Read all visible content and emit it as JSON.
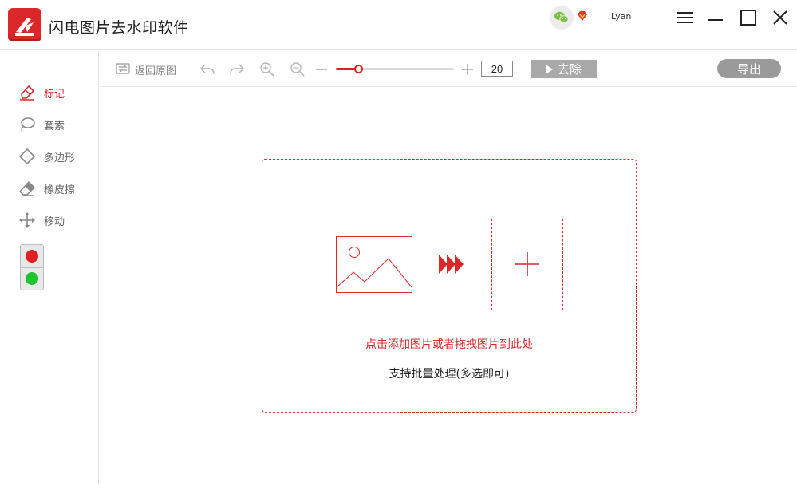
{
  "app": {
    "title": "闪电图片去水印软件",
    "username": "Lyan",
    "accent_color": "#d9272a"
  },
  "sidebar": {
    "tools": [
      {
        "label": "标记",
        "icon": "marker-icon",
        "active": true
      },
      {
        "label": "套索",
        "icon": "lasso-icon",
        "active": false
      },
      {
        "label": "多边形",
        "icon": "polygon-icon",
        "active": false
      },
      {
        "label": "橡皮擦",
        "icon": "eraser-icon",
        "active": false
      },
      {
        "label": "移动",
        "icon": "move-icon",
        "active": false
      }
    ],
    "color_switch": {
      "top": "#e02020",
      "bottom": "#1cc42e"
    }
  },
  "toolbar": {
    "back_label": "返回原图",
    "brush_size": "20",
    "brush_size_fraction": 0.19,
    "remove_label": "去除",
    "export_label": "导出"
  },
  "dropzone": {
    "hint": "点击添加图片或者拖拽图片到此处",
    "subhint": "支持批量处理(多选即可)"
  }
}
